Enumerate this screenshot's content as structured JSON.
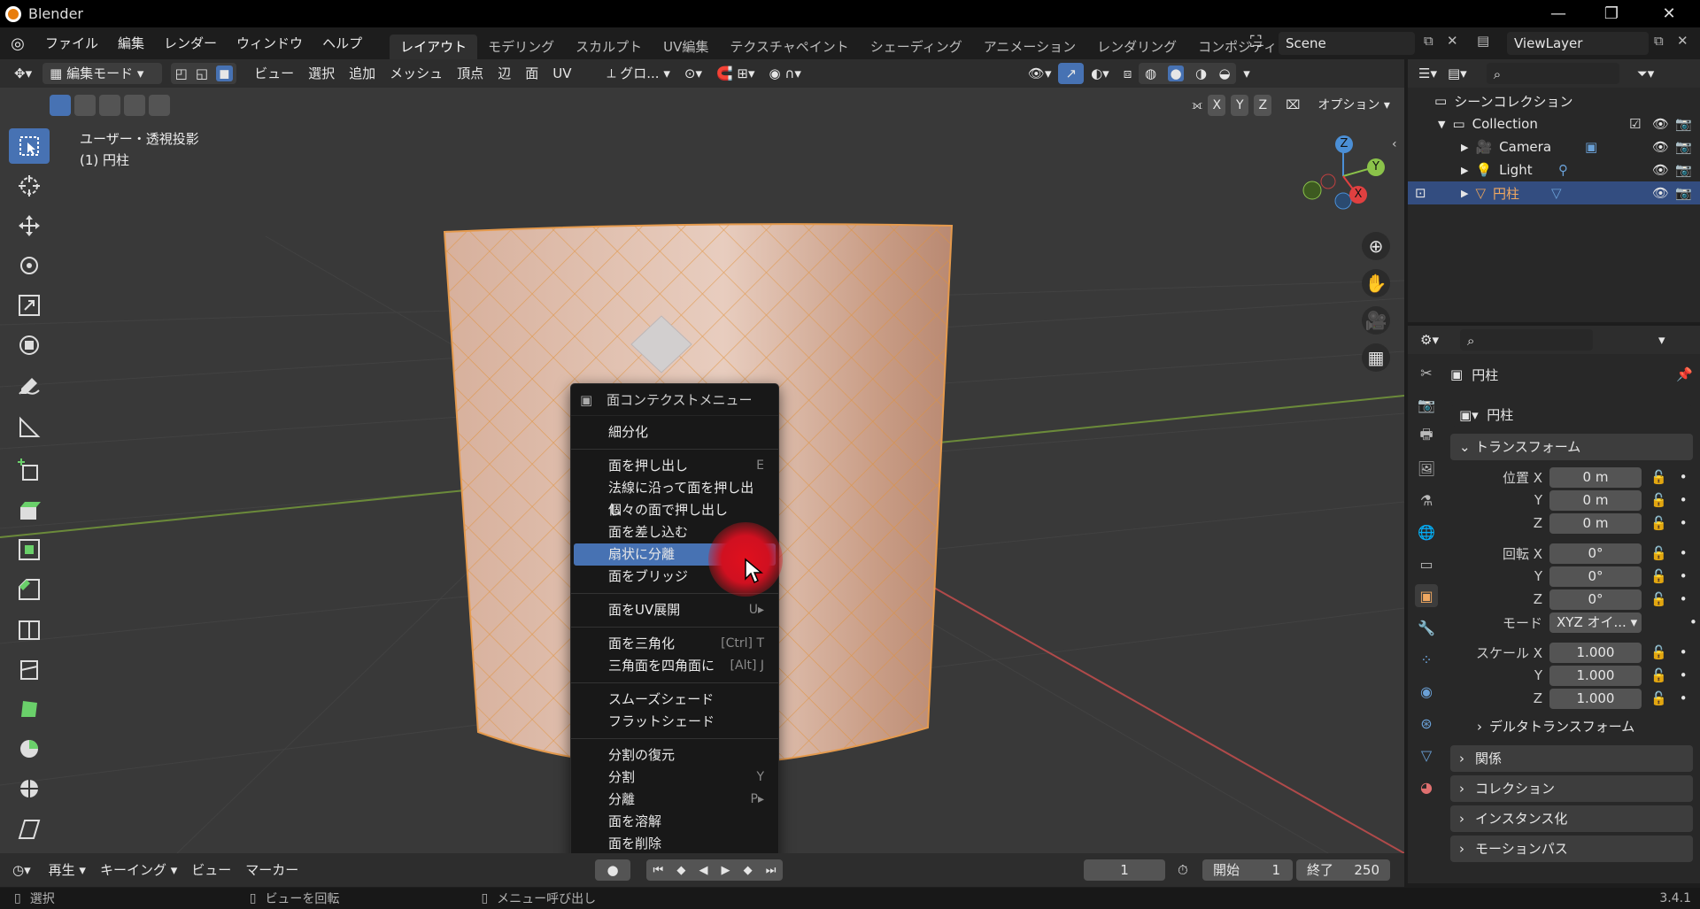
{
  "title": "Blender",
  "menus": [
    "ファイル",
    "編集",
    "レンダー",
    "ウィンドウ",
    "ヘルプ"
  ],
  "workspaces": [
    "レイアウト",
    "モデリング",
    "スカルプト",
    "UV編集",
    "テクスチャペイント",
    "シェーディング",
    "アニメーション",
    "レンダリング",
    "コンポジティン"
  ],
  "scene": "Scene",
  "viewlayer": "ViewLayer",
  "viewport_header": {
    "mode": "編集モード",
    "items": [
      "ビュー",
      "選択",
      "追加",
      "メッシュ",
      "頂点",
      "辺",
      "面",
      "UV"
    ],
    "transform": "グロ...",
    "axes": [
      "X",
      "Y",
      "Z"
    ],
    "options": "オプション"
  },
  "viewport_info": {
    "projection": "ユーザー・透視投影",
    "object": "(1) 円柱"
  },
  "gizmo": {
    "z": "Z",
    "y": "Y",
    "x": "X"
  },
  "context_menu": {
    "title": "面コンテクストメニュー",
    "groups": [
      [
        {
          "label": "細分化",
          "shortcut": ""
        }
      ],
      [
        {
          "label": "面を押し出し",
          "shortcut": "E"
        },
        {
          "label": "法線に沿って面を押し出し",
          "shortcut": ""
        },
        {
          "label": "個々の面で押し出し",
          "shortcut": ""
        },
        {
          "label": "面を差し込む",
          "shortcut": ""
        },
        {
          "label": "扇状に分離",
          "shortcut": ""
        },
        {
          "label": "面をブリッジ",
          "shortcut": ""
        }
      ],
      [
        {
          "label": "面をUV展開",
          "shortcut": "U▸"
        }
      ],
      [
        {
          "label": "面を三角化",
          "shortcut": "[Ctrl] T"
        },
        {
          "label": "三角面を四角面に",
          "shortcut": "[Alt] J"
        }
      ],
      [
        {
          "label": "スムーズシェード",
          "shortcut": ""
        },
        {
          "label": "フラットシェード",
          "shortcut": ""
        }
      ],
      [
        {
          "label": "分割の復元",
          "shortcut": ""
        },
        {
          "label": "分割",
          "shortcut": "Y"
        },
        {
          "label": "分離",
          "shortcut": "P▸"
        },
        {
          "label": "面を溶解",
          "shortcut": ""
        },
        {
          "label": "面を削除",
          "shortcut": ""
        }
      ]
    ],
    "highlighted": "扇状に分離"
  },
  "outliner": {
    "root": "シーンコレクション",
    "collection": "Collection",
    "items": [
      "Camera",
      "Light",
      "円柱"
    ]
  },
  "properties": {
    "object_name": "円柱",
    "data_name": "円柱",
    "transform_title": "トランスフォーム",
    "location_label": "位置 X",
    "rotation_label": "回転 X",
    "scale_label": "スケール X",
    "y": "Y",
    "z": "Z",
    "location": [
      "0 m",
      "0 m",
      "0 m"
    ],
    "rotation": [
      "0°",
      "0°",
      "0°"
    ],
    "mode_label": "モード",
    "mode": "XYZ オイ...",
    "scale": [
      "1.000",
      "1.000",
      "1.000"
    ],
    "sections": [
      "デルタトランスフォーム",
      "関係",
      "コレクション",
      "インスタンス化",
      "モーションパス"
    ]
  },
  "timeline": {
    "play": "再生",
    "keying": "キーイング",
    "view": "ビュー",
    "marker": "マーカー",
    "frame": "1",
    "start_label": "開始",
    "start": "1",
    "end_label": "終了",
    "end": "250"
  },
  "status": {
    "select": "選択",
    "rotate": "ビューを回転",
    "menu": "メニュー呼び出し",
    "version": "3.4.1"
  }
}
